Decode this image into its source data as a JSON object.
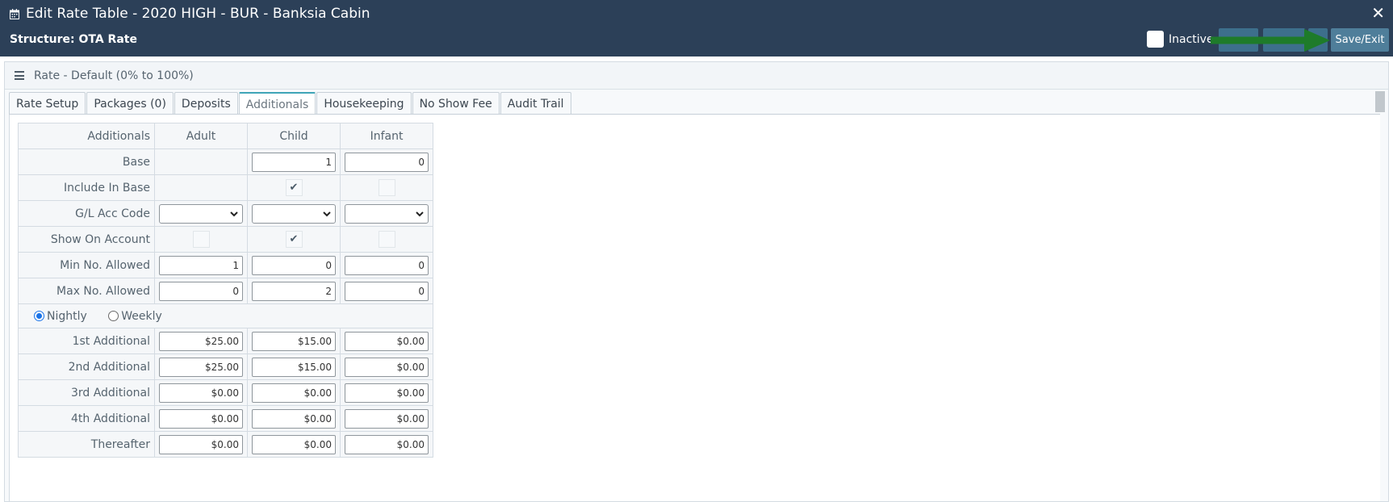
{
  "window": {
    "title": "Edit Rate Table - 2020 HIGH - BUR - Banksia Cabin",
    "structure": "Structure: OTA Rate",
    "inactive_label": "Inactive",
    "save_exit_label": "Save/Exit",
    "close_glyph": "✕"
  },
  "panel": {
    "heading": "Rate - Default (0% to 100%)"
  },
  "tabs": [
    {
      "label": "Rate Setup"
    },
    {
      "label": "Packages (0)"
    },
    {
      "label": "Deposits"
    },
    {
      "label": "Additionals",
      "active": true
    },
    {
      "label": "Housekeeping"
    },
    {
      "label": "No Show Fee"
    },
    {
      "label": "Audit Trail"
    }
  ],
  "grid": {
    "headers": [
      "Additionals",
      "Adult",
      "Child",
      "Infant"
    ],
    "base": {
      "label": "Base",
      "child": "1",
      "infant": "0"
    },
    "include_in_base": {
      "label": "Include In Base",
      "child_check": "✔"
    },
    "gl_code": {
      "label": "G/L Acc Code"
    },
    "show_on_account": {
      "label": "Show On Account",
      "child_check": "✔"
    },
    "min_allowed": {
      "label": "Min No. Allowed",
      "adult": "1",
      "child": "0",
      "infant": "0"
    },
    "max_allowed": {
      "label": "Max No. Allowed",
      "adult": "0",
      "child": "2",
      "infant": "0"
    },
    "frequency": {
      "nightly": "Nightly",
      "weekly": "Weekly"
    },
    "rows": [
      {
        "label": "1st Additional",
        "adult": "$25.00",
        "child": "$15.00",
        "infant": "$0.00"
      },
      {
        "label": "2nd Additional",
        "adult": "$25.00",
        "child": "$15.00",
        "infant": "$0.00"
      },
      {
        "label": "3rd Additional",
        "adult": "$0.00",
        "child": "$0.00",
        "infant": "$0.00"
      },
      {
        "label": "4th Additional",
        "adult": "$0.00",
        "child": "$0.00",
        "infant": "$0.00"
      },
      {
        "label": "Thereafter",
        "adult": "$0.00",
        "child": "$0.00",
        "infant": "$0.00"
      }
    ]
  },
  "colors": {
    "header_bg": "#2c4058",
    "save_button": "#4f7e9a",
    "toolbar_button": "#3d6f8c",
    "arrow": "#1e7b2a",
    "active_tab_accent": "#3fa5b7"
  }
}
